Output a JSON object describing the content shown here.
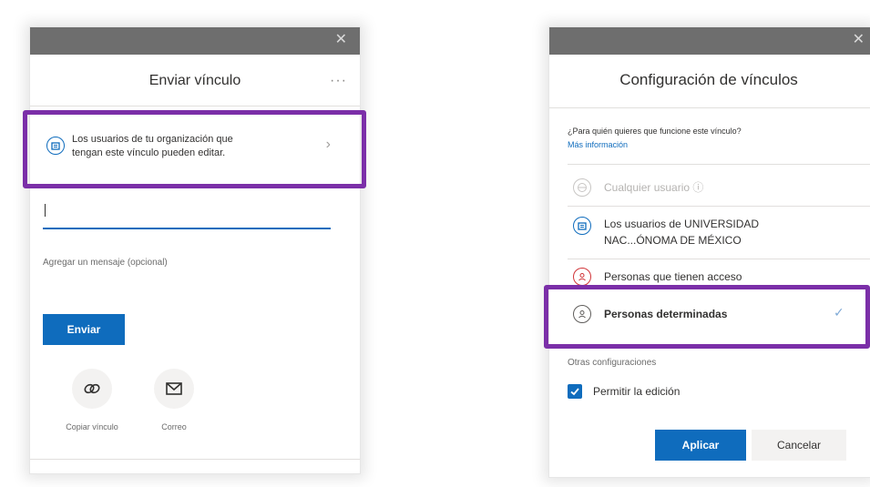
{
  "left_dialog": {
    "close": "✕",
    "title": "Enviar vínculo",
    "more": "···",
    "link_setting_line1": "Los usuarios de tu organización que",
    "link_setting_line2": "tengan este vínculo pueden editar.",
    "chevron": "›",
    "recipient_value": "",
    "message_placeholder": "Agregar un mensaje (opcional)",
    "send_button": "Enviar",
    "copy_link_label": "Copiar vínculo",
    "email_label": "Correo"
  },
  "right_dialog": {
    "close": "✕",
    "title": "Configuración de vínculos",
    "question": "¿Para quién quieres que funcione este vínculo?",
    "more_info": "Más información",
    "options": [
      {
        "label": "Cualquier usuario ⓘ",
        "state": "disabled"
      },
      {
        "label_line1": "Los usuarios de UNIVERSIDAD",
        "label_line2": "NAC...ÓNOMA DE MÉXICO",
        "state": "normal"
      },
      {
        "label": "Personas que tienen acceso",
        "state": "normal"
      },
      {
        "label": "Personas determinadas",
        "state": "selected",
        "check": "✓"
      }
    ],
    "other_settings": "Otras configuraciones",
    "allow_edit": "Permitir la edición",
    "allow_edit_checked": true,
    "apply_button": "Aplicar",
    "cancel_button": "Cancelar"
  },
  "colors": {
    "accent": "#0f6cbd",
    "highlight": "#7b2fa8",
    "titlebar": "#6e6e6e"
  }
}
